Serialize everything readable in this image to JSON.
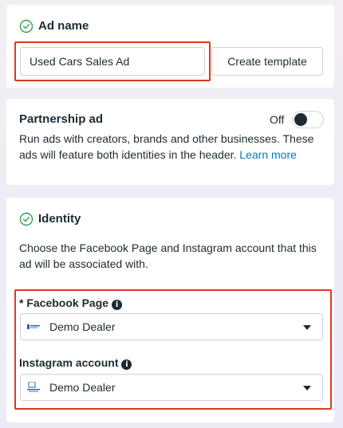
{
  "ad_name": {
    "title": "Ad name",
    "input_value": "Used Cars Sales Ad",
    "create_template_label": "Create template"
  },
  "partnership": {
    "title": "Partnership ad",
    "toggle_label": "Off",
    "toggle_state": "off",
    "description": "Run ads with creators, brands and other businesses. These ads will feature both identities in the header.",
    "learn_more": "Learn more"
  },
  "identity": {
    "title": "Identity",
    "description": "Choose the Facebook Page and Instagram account that this ad will be associated with.",
    "facebook_page": {
      "label": "* Facebook Page",
      "value": "Demo Dealer"
    },
    "instagram_account": {
      "label": "Instagram account",
      "value": "Demo Dealer"
    }
  },
  "colors": {
    "highlight": "#e0371f",
    "success_check": "#31a24c",
    "link": "#0a78be",
    "text": "#1c2b33"
  }
}
